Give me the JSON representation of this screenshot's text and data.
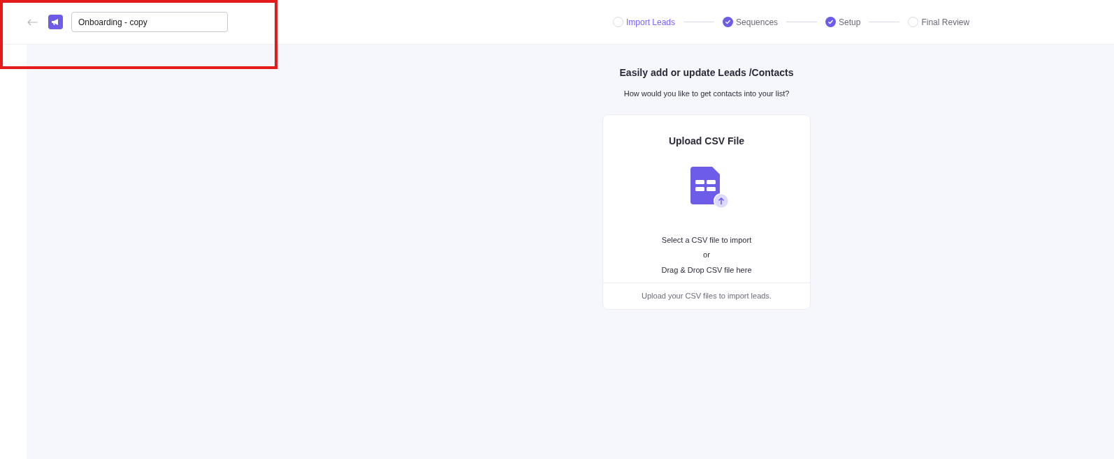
{
  "header": {
    "campaign_name": "Onboarding - copy"
  },
  "steps": [
    {
      "label": "Import Leads",
      "selected": true,
      "checked": false
    },
    {
      "label": "Sequences",
      "selected": false,
      "checked": true
    },
    {
      "label": "Setup",
      "selected": false,
      "checked": true
    },
    {
      "label": "Final Review",
      "selected": false,
      "checked": false
    }
  ],
  "import": {
    "title": "Easily add or update Leads /Contacts",
    "subtitle": "How would you like to get contacts into your list?"
  },
  "upload_card": {
    "title": "Upload CSV File",
    "lines": [
      "Select a CSV file to import",
      "or",
      "Drag & Drop CSV file here"
    ],
    "footer": "Upload your CSV files to import leads."
  }
}
